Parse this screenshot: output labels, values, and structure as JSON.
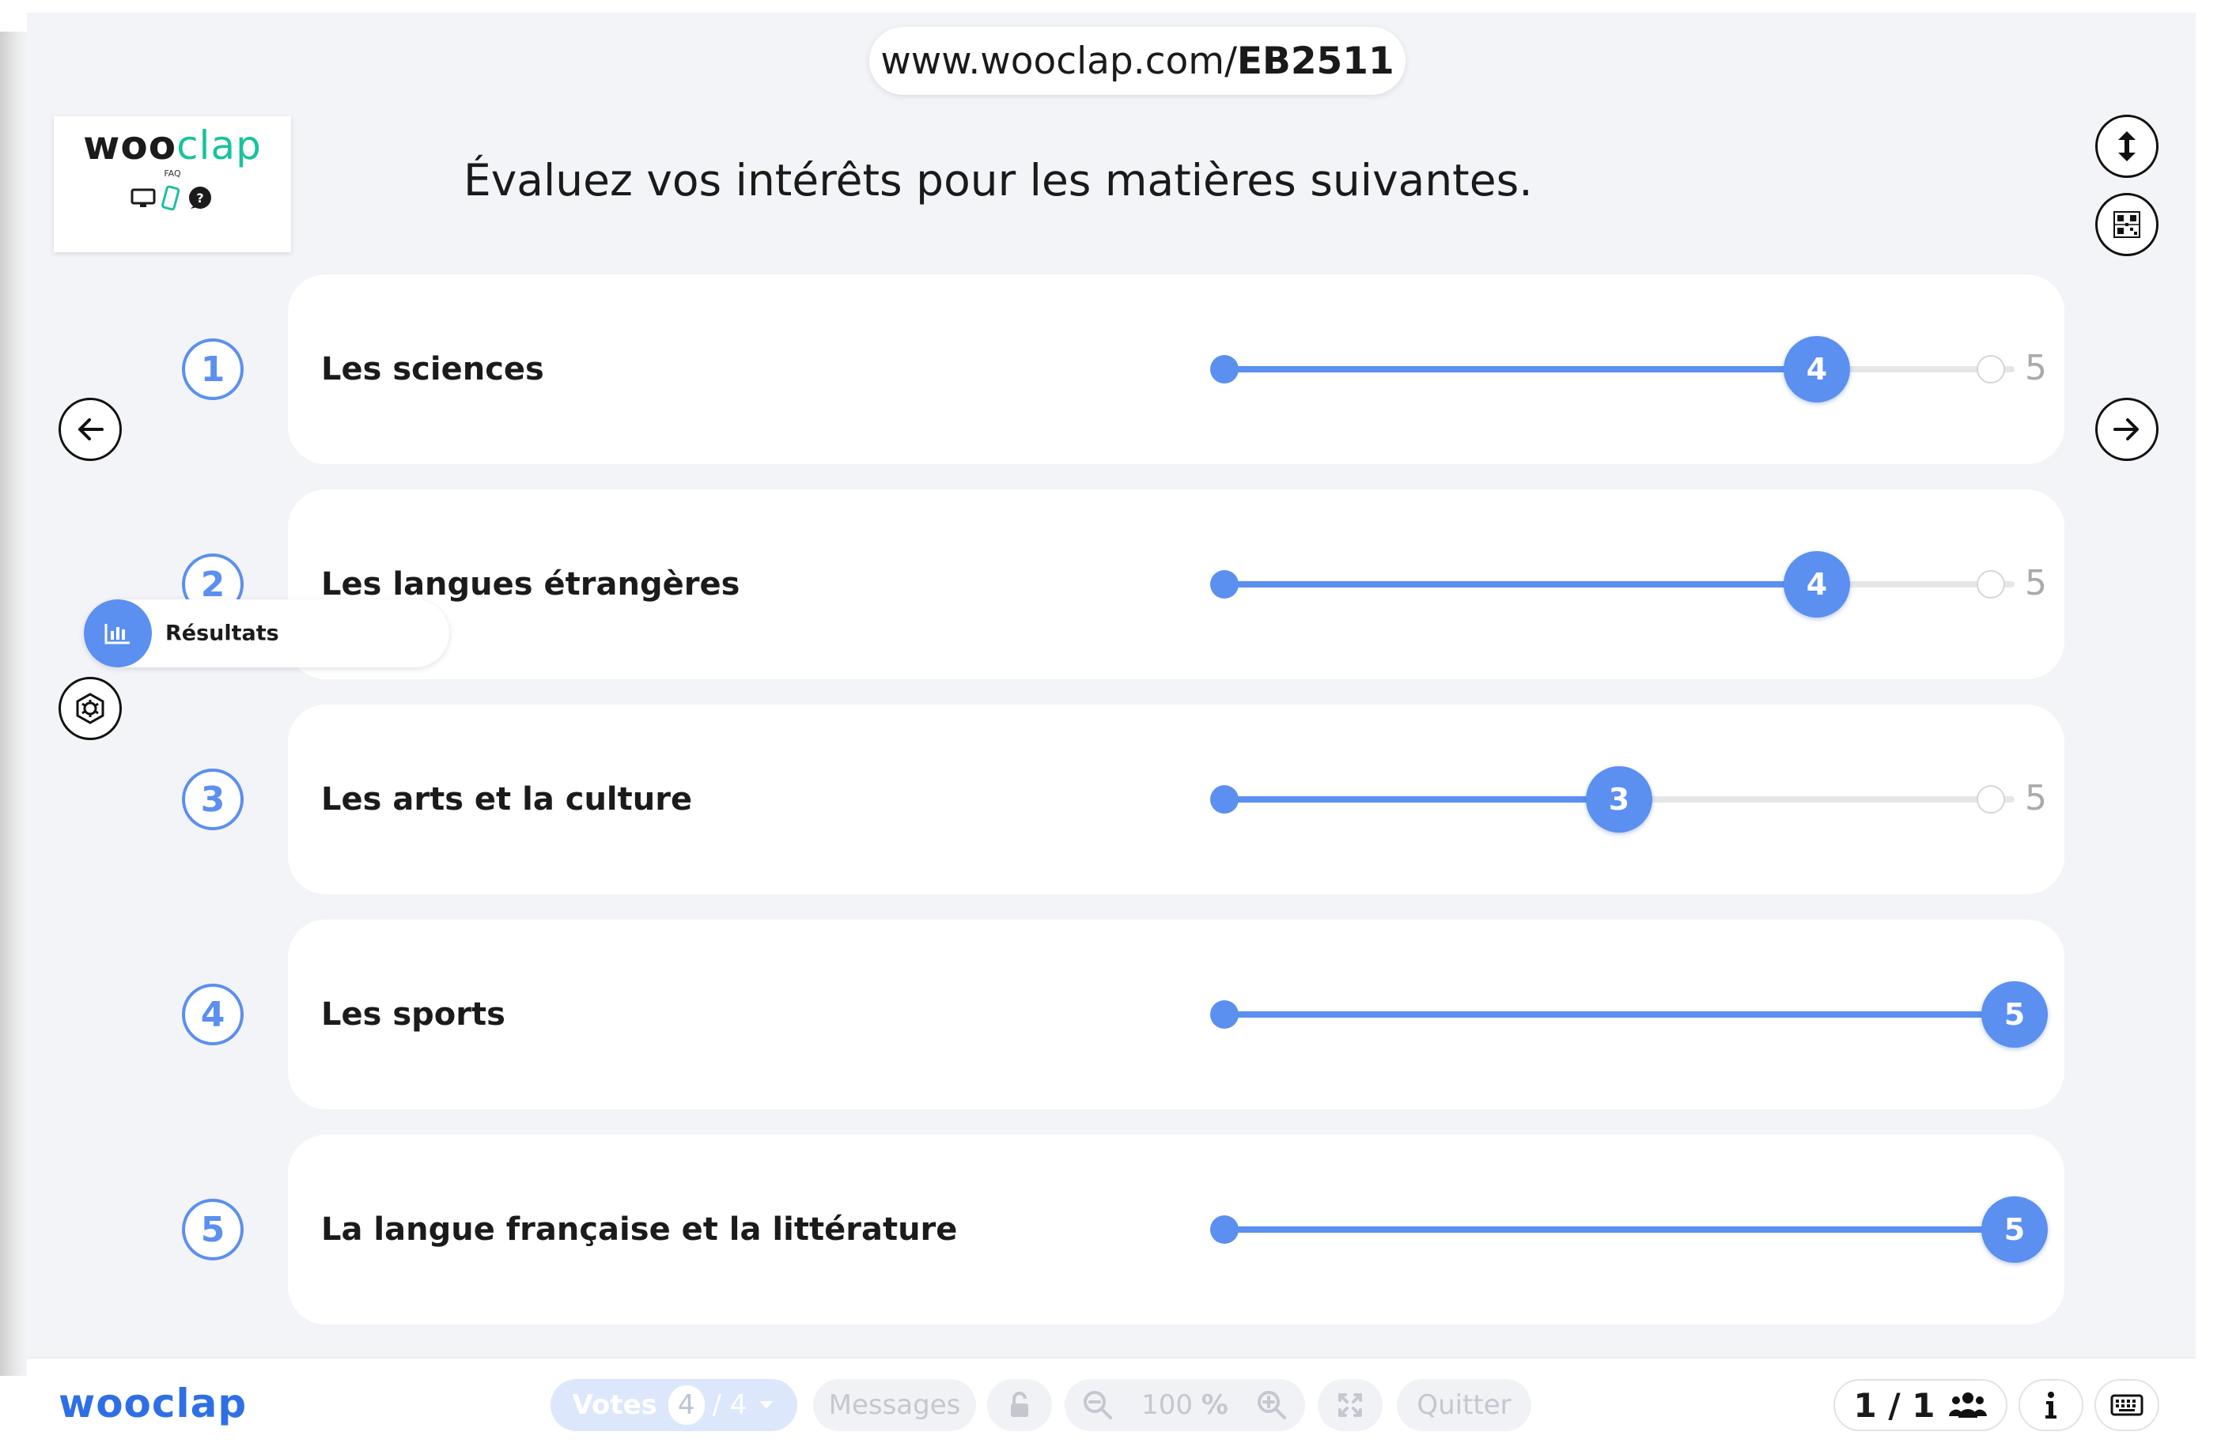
{
  "header": {
    "url_prefix": "www.wooclap.com/",
    "event_code": "EB2511"
  },
  "logo": {
    "brand_part1": "woo",
    "brand_part2": "clap",
    "faq_label": "FAQ"
  },
  "question": {
    "title": "Évaluez vos intérêts pour les matières suivantes."
  },
  "scale_max": 5,
  "items": [
    {
      "number": "1",
      "label": "Les sciences",
      "value": 4,
      "value_label": "4",
      "max_label": "5"
    },
    {
      "number": "2",
      "label": "Les langues étrangères",
      "value": 4,
      "value_label": "4",
      "max_label": "5"
    },
    {
      "number": "3",
      "label": "Les arts et la culture",
      "value": 3,
      "value_label": "3",
      "max_label": "5"
    },
    {
      "number": "4",
      "label": "Les sports",
      "value": 5,
      "value_label": "5",
      "max_label": ""
    },
    {
      "number": "5",
      "label": "La langue française et la littérature",
      "value": 5,
      "value_label": "5",
      "max_label": ""
    }
  ],
  "side_menu": {
    "results_label": "Résultats"
  },
  "bottom_bar": {
    "brand": "wooclap",
    "votes_label": "Votes",
    "votes_count": "4",
    "votes_total": "/ 4",
    "messages_label": "Messages",
    "zoom_value": "100",
    "zoom_unit": "%",
    "quit_label": "Quitter",
    "participants": "1 / 1"
  },
  "colors": {
    "accent": "#5b8ff0",
    "brand_green": "#19c39c",
    "brand_blue": "#2f6fe6",
    "background": "#f3f4f8"
  },
  "icons": {
    "prev": "arrow-left-icon",
    "next": "arrow-right-icon",
    "resize": "vertical-arrows-icon",
    "qr": "qr-code-icon",
    "results": "bar-chart-icon",
    "settings": "gear-icon",
    "participants": "users-icon",
    "info": "info-icon",
    "keyboard": "keyboard-icon"
  }
}
